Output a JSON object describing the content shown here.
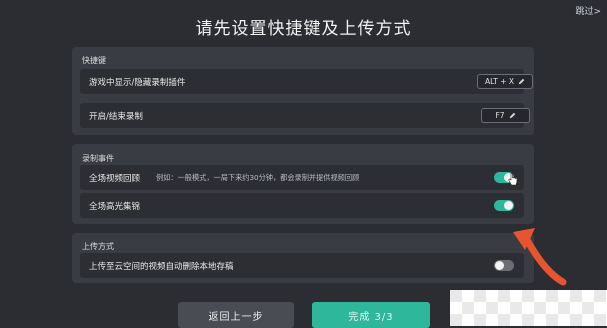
{
  "header": {
    "skip_label": "跳过>",
    "title": "请先设置快捷键及上传方式"
  },
  "hotkeys": {
    "title": "快捷键",
    "items": [
      {
        "label": "游戏中显示/隐藏录制插件",
        "key": "ALT + X"
      },
      {
        "label": "开启/结束录制",
        "key": "F7"
      }
    ]
  },
  "record_events": {
    "title": "录制事件",
    "items": [
      {
        "label": "全场视频回顾",
        "hint": "例如：一般模式，一局下来约30分钟，都会录制并提供视频回顾",
        "enabled": true
      },
      {
        "label": "全场高光集锦",
        "enabled": true
      }
    ]
  },
  "upload": {
    "title": "上传方式",
    "items": [
      {
        "label": "上传至云空间的视频自动删除本地存稿",
        "enabled": false
      }
    ]
  },
  "footer": {
    "back_label": "返回上一步",
    "done_label": "完成  3/3"
  },
  "colors": {
    "accent": "#2fb79c",
    "annotation_arrow": "#e8542f"
  },
  "icons": {
    "edit": "pencil-icon",
    "cursor": "hand-cursor-icon"
  }
}
